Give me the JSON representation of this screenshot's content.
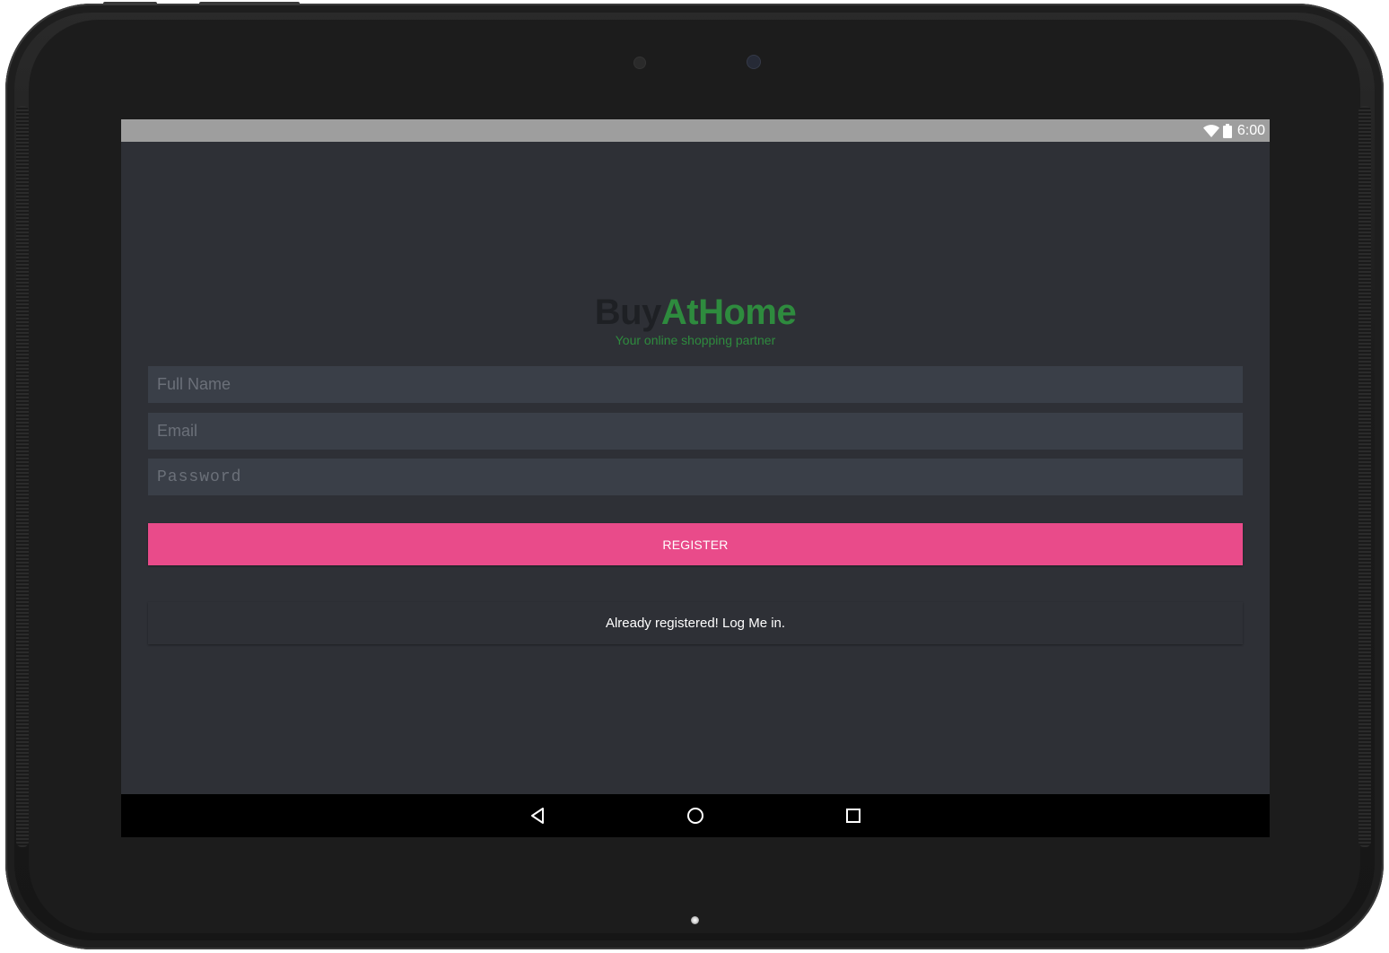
{
  "status_bar": {
    "time": "6:00",
    "icons": [
      "wifi-icon",
      "battery-icon"
    ]
  },
  "logo": {
    "part1": "Buy",
    "part2": "AtHome",
    "tagline": "Your online shopping partner"
  },
  "form": {
    "full_name": {
      "placeholder": "Full Name",
      "value": ""
    },
    "email": {
      "placeholder": "Email",
      "value": ""
    },
    "password": {
      "placeholder": "Password",
      "value": ""
    },
    "register_label": "REGISTER",
    "login_label": "Already registered! Log Me in."
  },
  "nav_bar": {
    "icons": [
      "back-icon",
      "home-icon",
      "recents-icon"
    ]
  },
  "colors": {
    "background": "#2e3036",
    "field_background": "#3a3f48",
    "accent_pink": "#e94b8a",
    "brand_green": "#2e8b3e",
    "brand_dark": "#1e2024",
    "status_bar": "#9e9e9e",
    "nav_bar": "#000000"
  }
}
